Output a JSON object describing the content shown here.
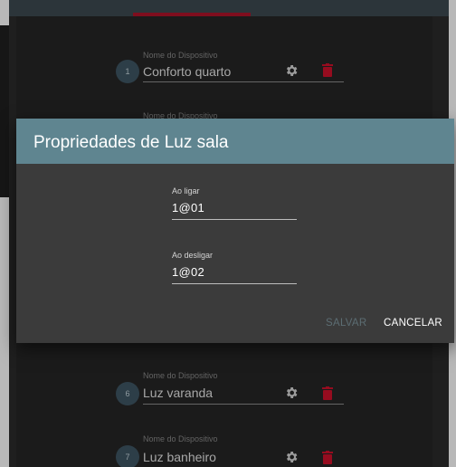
{
  "device_list": {
    "field_label": "Nome do Dispositivo",
    "items": [
      {
        "number": "1",
        "name": "Conforto quarto"
      },
      {
        "number": "6",
        "name": "Luz varanda"
      },
      {
        "number": "7",
        "name": "Luz banheiro"
      }
    ],
    "partial_label": "Nome do Dispositivo"
  },
  "dialog": {
    "title": "Propriedades de Luz sala",
    "fields": [
      {
        "label": "Ao ligar",
        "value": "1@01"
      },
      {
        "label": "Ao desligar",
        "value": "1@02"
      }
    ],
    "save_label": "SALVAR",
    "cancel_label": "CANCELAR"
  },
  "colors": {
    "dialog_header": "#5f8590",
    "badge": "#3f5765",
    "trash": "#d0112b",
    "save_disabled": "#5c6d73"
  },
  "icons": [
    "gear-icon",
    "trash-icon"
  ]
}
